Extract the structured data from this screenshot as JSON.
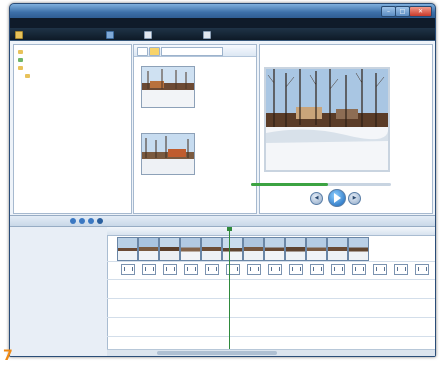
{
  "window": {
    "title": "",
    "minimize": "–",
    "maximize": "□",
    "close": "✕"
  },
  "menu": [
    "",
    "",
    "",
    "",
    "",
    "",
    ""
  ],
  "toolbar": {
    "items": [
      "",
      "",
      "",
      ""
    ]
  },
  "left_pane": {
    "tree": [
      "",
      "",
      "",
      ""
    ]
  },
  "collection": {
    "dropdown": "",
    "captions": [
      "",
      ""
    ]
  },
  "preview": {
    "split_link": "",
    "play_label": "",
    "progress_pct": 55
  },
  "timeline": {
    "toolbar_label": "",
    "rows": [
      "",
      "",
      "",
      "",
      "",
      ""
    ],
    "ruler": [
      "",
      "",
      "",
      "",
      "",
      "",
      "",
      "",
      ""
    ]
  },
  "badge": "7",
  "colors": {
    "title_bar": "#4f7fb3",
    "dark_toolbar": "#0f1b2a",
    "accent_green": "#3ca342",
    "page_badge": "#f08a14"
  },
  "icons": [
    "minimize-icon",
    "maximize-icon",
    "close-icon",
    "folder-icon",
    "play-icon",
    "rewind-icon",
    "fast-forward-icon",
    "zoom-in-icon",
    "zoom-out-icon"
  ]
}
